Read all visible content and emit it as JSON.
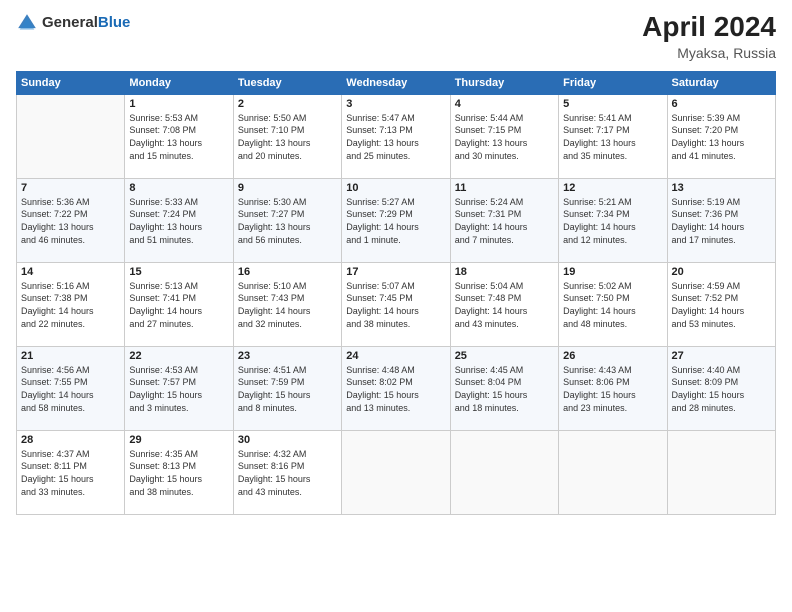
{
  "header": {
    "logo_general": "General",
    "logo_blue": "Blue",
    "title": "April 2024",
    "location": "Myaksa, Russia"
  },
  "columns": [
    "Sunday",
    "Monday",
    "Tuesday",
    "Wednesday",
    "Thursday",
    "Friday",
    "Saturday"
  ],
  "weeks": [
    [
      {
        "day": "",
        "info": ""
      },
      {
        "day": "1",
        "info": "Sunrise: 5:53 AM\nSunset: 7:08 PM\nDaylight: 13 hours\nand 15 minutes."
      },
      {
        "day": "2",
        "info": "Sunrise: 5:50 AM\nSunset: 7:10 PM\nDaylight: 13 hours\nand 20 minutes."
      },
      {
        "day": "3",
        "info": "Sunrise: 5:47 AM\nSunset: 7:13 PM\nDaylight: 13 hours\nand 25 minutes."
      },
      {
        "day": "4",
        "info": "Sunrise: 5:44 AM\nSunset: 7:15 PM\nDaylight: 13 hours\nand 30 minutes."
      },
      {
        "day": "5",
        "info": "Sunrise: 5:41 AM\nSunset: 7:17 PM\nDaylight: 13 hours\nand 35 minutes."
      },
      {
        "day": "6",
        "info": "Sunrise: 5:39 AM\nSunset: 7:20 PM\nDaylight: 13 hours\nand 41 minutes."
      }
    ],
    [
      {
        "day": "7",
        "info": "Sunrise: 5:36 AM\nSunset: 7:22 PM\nDaylight: 13 hours\nand 46 minutes."
      },
      {
        "day": "8",
        "info": "Sunrise: 5:33 AM\nSunset: 7:24 PM\nDaylight: 13 hours\nand 51 minutes."
      },
      {
        "day": "9",
        "info": "Sunrise: 5:30 AM\nSunset: 7:27 PM\nDaylight: 13 hours\nand 56 minutes."
      },
      {
        "day": "10",
        "info": "Sunrise: 5:27 AM\nSunset: 7:29 PM\nDaylight: 14 hours\nand 1 minute."
      },
      {
        "day": "11",
        "info": "Sunrise: 5:24 AM\nSunset: 7:31 PM\nDaylight: 14 hours\nand 7 minutes."
      },
      {
        "day": "12",
        "info": "Sunrise: 5:21 AM\nSunset: 7:34 PM\nDaylight: 14 hours\nand 12 minutes."
      },
      {
        "day": "13",
        "info": "Sunrise: 5:19 AM\nSunset: 7:36 PM\nDaylight: 14 hours\nand 17 minutes."
      }
    ],
    [
      {
        "day": "14",
        "info": "Sunrise: 5:16 AM\nSunset: 7:38 PM\nDaylight: 14 hours\nand 22 minutes."
      },
      {
        "day": "15",
        "info": "Sunrise: 5:13 AM\nSunset: 7:41 PM\nDaylight: 14 hours\nand 27 minutes."
      },
      {
        "day": "16",
        "info": "Sunrise: 5:10 AM\nSunset: 7:43 PM\nDaylight: 14 hours\nand 32 minutes."
      },
      {
        "day": "17",
        "info": "Sunrise: 5:07 AM\nSunset: 7:45 PM\nDaylight: 14 hours\nand 38 minutes."
      },
      {
        "day": "18",
        "info": "Sunrise: 5:04 AM\nSunset: 7:48 PM\nDaylight: 14 hours\nand 43 minutes."
      },
      {
        "day": "19",
        "info": "Sunrise: 5:02 AM\nSunset: 7:50 PM\nDaylight: 14 hours\nand 48 minutes."
      },
      {
        "day": "20",
        "info": "Sunrise: 4:59 AM\nSunset: 7:52 PM\nDaylight: 14 hours\nand 53 minutes."
      }
    ],
    [
      {
        "day": "21",
        "info": "Sunrise: 4:56 AM\nSunset: 7:55 PM\nDaylight: 14 hours\nand 58 minutes."
      },
      {
        "day": "22",
        "info": "Sunrise: 4:53 AM\nSunset: 7:57 PM\nDaylight: 15 hours\nand 3 minutes."
      },
      {
        "day": "23",
        "info": "Sunrise: 4:51 AM\nSunset: 7:59 PM\nDaylight: 15 hours\nand 8 minutes."
      },
      {
        "day": "24",
        "info": "Sunrise: 4:48 AM\nSunset: 8:02 PM\nDaylight: 15 hours\nand 13 minutes."
      },
      {
        "day": "25",
        "info": "Sunrise: 4:45 AM\nSunset: 8:04 PM\nDaylight: 15 hours\nand 18 minutes."
      },
      {
        "day": "26",
        "info": "Sunrise: 4:43 AM\nSunset: 8:06 PM\nDaylight: 15 hours\nand 23 minutes."
      },
      {
        "day": "27",
        "info": "Sunrise: 4:40 AM\nSunset: 8:09 PM\nDaylight: 15 hours\nand 28 minutes."
      }
    ],
    [
      {
        "day": "28",
        "info": "Sunrise: 4:37 AM\nSunset: 8:11 PM\nDaylight: 15 hours\nand 33 minutes."
      },
      {
        "day": "29",
        "info": "Sunrise: 4:35 AM\nSunset: 8:13 PM\nDaylight: 15 hours\nand 38 minutes."
      },
      {
        "day": "30",
        "info": "Sunrise: 4:32 AM\nSunset: 8:16 PM\nDaylight: 15 hours\nand 43 minutes."
      },
      {
        "day": "",
        "info": ""
      },
      {
        "day": "",
        "info": ""
      },
      {
        "day": "",
        "info": ""
      },
      {
        "day": "",
        "info": ""
      }
    ]
  ]
}
